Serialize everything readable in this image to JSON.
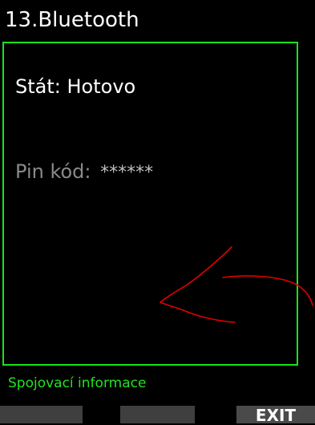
{
  "header": {
    "title": "13.Bluetooth"
  },
  "panel": {
    "status_label": "Stát:",
    "status_value": "Hotovo",
    "pin_label": "Pin kód:",
    "pin_value": "******"
  },
  "footer": {
    "section_label": "Spojovací informace",
    "softkeys": [
      "",
      "",
      "EXIT"
    ]
  },
  "colors": {
    "background": "#000000",
    "panel_border": "#19e219",
    "info_label": "#22e122",
    "annotation_stroke": "#e00000"
  }
}
